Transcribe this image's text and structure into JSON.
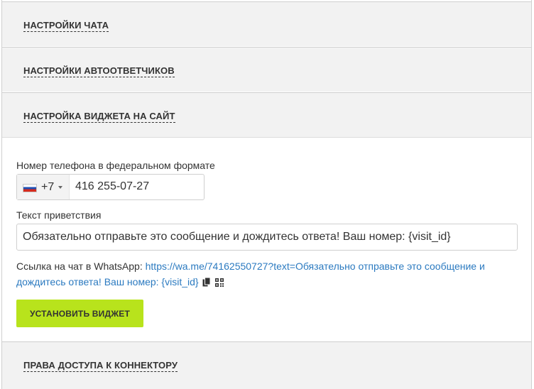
{
  "sections": {
    "chat_settings": "НАСТРОЙКИ ЧАТА",
    "autoresponder_settings": "НАСТРОЙКИ АВТООТВЕТЧИКОВ",
    "widget_settings": "НАСТРОЙКА ВИДЖЕТА НА САЙТ",
    "connector_access": "ПРАВА ДОСТУПА К КОННЕКТОРУ"
  },
  "widget": {
    "phone_label": "Номер телефона в федеральном формате",
    "country_code": "+7",
    "country_flag": "russia-flag-icon",
    "phone_value": "416 255-07-27",
    "greeting_label": "Текст приветствия",
    "greeting_value": "Обязательно отправьте это сообщение и дождитесь ответа! Ваш номер: {visit_id}",
    "link_label": "Ссылка на чат в WhatsApp: ",
    "link_url": "https://wa.me/74162550727?text=Обязательно отправьте это сообщение и дождитесь ответа! Ваш номер: {visit_id}",
    "copy_icon": "copy-icon",
    "qr_icon": "qr-code-icon",
    "install_button": "УСТАНОВИТЬ ВИДЖЕТ"
  },
  "colors": {
    "header_bg": "#f2f2f2",
    "link": "#2b7ac0",
    "button": "#b8e31c"
  }
}
